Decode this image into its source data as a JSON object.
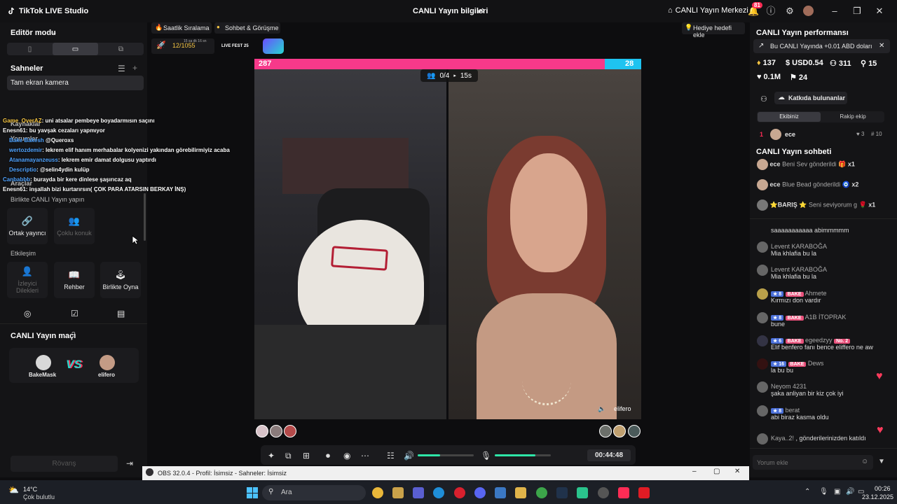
{
  "app": {
    "title": "TikTok LIVE Studio",
    "center_title": "CANLI Yayın bilgileri",
    "live_center": "CANLI Yayın Merkezi",
    "notif_count": "81"
  },
  "left": {
    "editor_mode": "Editör modu",
    "scenes_title": "Sahneler",
    "scene_item": "Tam ekran kamera",
    "sources_title": "Kaynaklar",
    "comments_title": "Yorumlar",
    "tools_title": "Araçlar",
    "together_title": "Birlikte CANLI Yayın yapın",
    "cohost": "Ortak yayıncı",
    "multi_guest": "Çoklu konuk",
    "interaction": "Etkileşim",
    "viewer_requests": "İzleyici Dilekleri",
    "guide": "Rehber",
    "play_together": "Birlikte Oyna",
    "match_title": "CANLI Yayın maçı",
    "player_left": "BakeMask",
    "player_right": "elifero",
    "vs": "VS",
    "rematch": "Rövanş"
  },
  "chat_overlay": [
    {
      "user": "Game_OverAZ",
      "text": ": uni atsalar pembeye boyadarmısın saçını"
    },
    {
      "user": "Enesn61",
      "text": ": bu yavşak cezaları yapmıyor"
    },
    {
      "user": "Bake Bakesh",
      "text": " @Queroxs"
    },
    {
      "user": "wertozdemir",
      "text": ": lekrem elif hanım merhabalar kolyenizi yakından görebilirmiyiz acaba"
    },
    {
      "user": "Atanamayanzeuss",
      "text": ": lekrem emir damat dolgusu yaptırdı"
    },
    {
      "user": "Descriptio",
      "text": ": @selin4ydin kulüp"
    },
    {
      "user": "Canbabbb",
      "text": ": burayda bir kere dinlese şaşırıcaz aq"
    },
    {
      "user": "Enesn61",
      "text": ": inşallah bizi kurtarırsın( ÇOK PARA ATARSIN BERKAY İNŞ)"
    }
  ],
  "center": {
    "tab_hourly": "Saatlik Sıralama",
    "tab_chat": "Sohbet & Görüşme",
    "goal_progress": "12/1055",
    "goal_time": "15 sa dk 16 sn",
    "live_fest": "LIVE FEST 25",
    "gift_goal": "Hediye hedefi ekle",
    "score_left": "287",
    "score_right": "28",
    "slots": "0/4",
    "countdown": "15s",
    "right_name": "elifero",
    "timer": "00:44:48",
    "volume_level": 0.4,
    "mic_level": 0.72
  },
  "right": {
    "perf_title": "CANLI Yayın performansı",
    "promo": "Bu CANLI Yayında +0.01 ABD doları",
    "stat_diamonds": "137",
    "stat_usd": "USD0.54",
    "stat_viewers": "311",
    "stat_new": "15",
    "stat_likes": "0.1M",
    "stat_subs": "24",
    "contributors": "Katkıda bulunanlar",
    "tab_ours": "Ekibiniz",
    "tab_rival": "Rakip ekip",
    "top_rank": "1",
    "top_name": "ece",
    "top_hearts": "3",
    "top_score": "10",
    "chat_title": "CANLI Yayın sohbeti",
    "gifts": [
      {
        "user": "ece",
        "text": "Beni Sev gönderildi",
        "count": "x1"
      },
      {
        "user": "ece",
        "text": "Blue Bead gönderildi",
        "count": "x2"
      },
      {
        "user": "BARIŞ",
        "text": "Seni seviyorum g",
        "count": "x1"
      }
    ],
    "messages": [
      {
        "name": "",
        "text": "saaaaaaaaaaa abimmmmm"
      },
      {
        "name": "Levent KARABOĞA",
        "text": "Mia khlafia bu la"
      },
      {
        "name": "Levent KARABOĞA",
        "text": "Mia khlafia bu la"
      },
      {
        "name": "Ahmete",
        "text": "Kırmızı don vardır",
        "lvl": "8",
        "team": "BAKE"
      },
      {
        "name": "A1B İTOPRAK",
        "text": "bune",
        "lvl": "8",
        "team": "BAKE"
      },
      {
        "name": "egeedzyy",
        "text": "Elif benfero fanı bence eliffero ne aw",
        "lvl": "6",
        "team": "BAKE",
        "extra": "No. 2"
      },
      {
        "name": "Dews",
        "text": "la bu bu",
        "lvl": "16",
        "team": "BAKE"
      },
      {
        "name": "Neyom 4231",
        "text": "şaka anliyan bir kiz çok iyi"
      },
      {
        "name": "berat",
        "text": "abi biraz kasma oldu",
        "lvl": "8"
      },
      {
        "name": "Kaya..2!",
        "text": ", gönderilerinizden katıldı"
      }
    ],
    "comment_placeholder": "Yorum ekle"
  },
  "obs": {
    "title": "OBS 32.0.4 - Profil: İsimsiz - Sahneler: İsimsiz"
  },
  "taskbar": {
    "temp": "14°C",
    "weather": "Çok bulutlu",
    "search": "Ara",
    "time": "00:26",
    "date": "23.12.2025"
  }
}
